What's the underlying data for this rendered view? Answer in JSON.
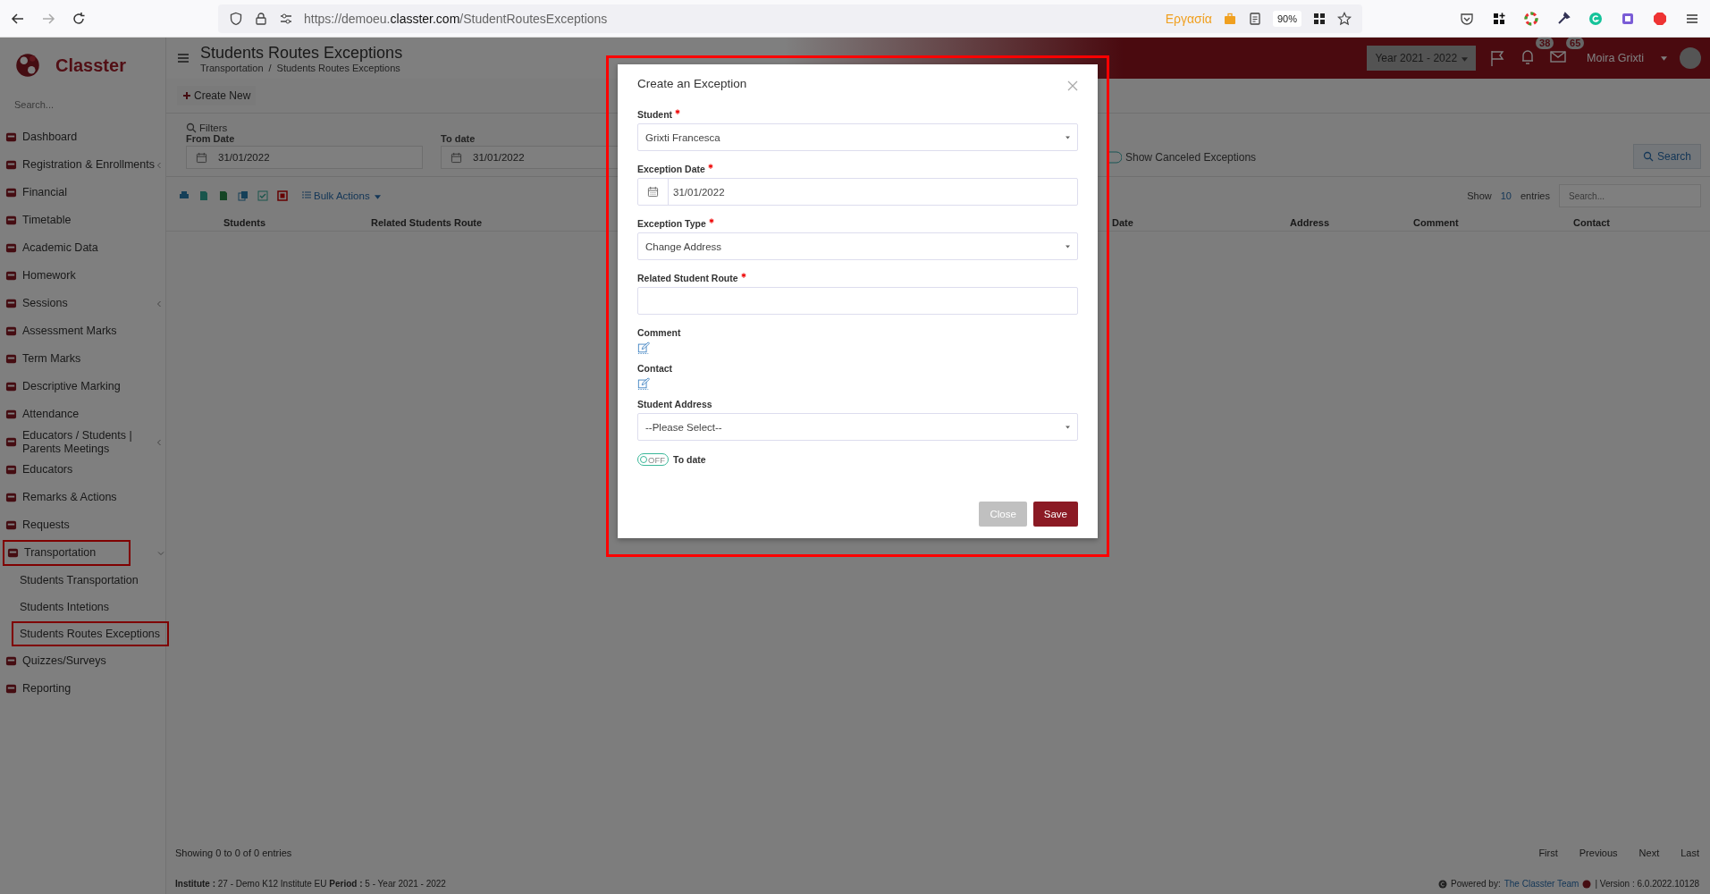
{
  "browser": {
    "url_start": "https://demoeu.",
    "url_domain": "classter.com",
    "url_path": "/StudentRoutesExceptions",
    "container": "Εργασία",
    "zoom": "90%"
  },
  "header": {
    "logo": "Classter",
    "search_placeholder": "Search...",
    "title": "Students Routes Exceptions",
    "breadcrumb": [
      "Transportation",
      "Students Routes Exceptions"
    ],
    "breadcrumb_separator": "/",
    "year": "Year 2021 - 2022",
    "notifications": "38",
    "messages": "65",
    "user": "Moira Grixti"
  },
  "sidebar": {
    "items": [
      {
        "label": "Dashboard",
        "kind": "link",
        "annotated": false
      },
      {
        "label": "Registration & Enrollments",
        "kind": "group",
        "annotated": false
      },
      {
        "label": "Financial",
        "kind": "link",
        "annotated": false
      },
      {
        "label": "Timetable",
        "kind": "link",
        "annotated": false
      },
      {
        "label": "Academic Data",
        "kind": "link",
        "annotated": false
      },
      {
        "label": "Homework",
        "kind": "link",
        "annotated": false
      },
      {
        "label": "Sessions",
        "kind": "group",
        "annotated": false
      },
      {
        "label": "Assessment Marks",
        "kind": "link",
        "annotated": false
      },
      {
        "label": "Term Marks",
        "kind": "link",
        "annotated": false
      },
      {
        "label": "Descriptive Marking",
        "kind": "link",
        "annotated": false
      },
      {
        "label": "Attendance",
        "kind": "link",
        "annotated": false
      },
      {
        "label": "Educators / Students | Parents Meetings",
        "kind": "group",
        "annotated": false
      },
      {
        "label": "Educators",
        "kind": "link",
        "annotated": false
      },
      {
        "label": "Remarks & Actions",
        "kind": "link",
        "annotated": false
      },
      {
        "label": "Requests",
        "kind": "link",
        "annotated": false
      },
      {
        "label": "Transportation",
        "kind": "group",
        "annotated": true,
        "children": [
          {
            "label": "Students Transportation",
            "annotated": false
          },
          {
            "label": "Students Intetions",
            "annotated": false
          },
          {
            "label": "Students Routes Exceptions",
            "annotated": true
          }
        ]
      },
      {
        "label": "Quizzes/Surveys",
        "kind": "link",
        "annotated": false
      },
      {
        "label": "Reporting",
        "kind": "link",
        "annotated": false
      }
    ]
  },
  "toolbar": {
    "create_label": "Create New"
  },
  "filters": {
    "title": "Filters",
    "from_label": "From Date",
    "from_value": "31/01/2022",
    "to_label": "To date",
    "to_value": "31/01/2022",
    "canceled_label": "Show Canceled Exceptions",
    "search_label": "Search"
  },
  "table": {
    "bulk_label": "Bulk Actions",
    "show_label": "Show",
    "page_size": "10",
    "entries_label": "entries",
    "search_placeholder": "Search...",
    "columns_left": [
      "Students",
      "Related Students Route"
    ],
    "columns_right": [
      "Date",
      "Address",
      "Comment",
      "Contact"
    ],
    "info": "Showing 0 to 0 of 0 entries",
    "pager": [
      "First",
      "Previous",
      "Next",
      "Last"
    ]
  },
  "status_bar": {
    "institute": "**Institute :** 27 - Demo K12 Institute EU **Period :** 5 - Year 2021 - 2022",
    "powered_label": "Powered by:",
    "powered_link": "The Classter Team",
    "version": "| Version : 6.0.2022.10128"
  },
  "modal": {
    "title": "Create an Exception",
    "annotated": true,
    "fields": [
      {
        "kind": "select",
        "label": "Student",
        "required": true,
        "value": "Grixti Francesca"
      },
      {
        "kind": "date",
        "label": "Exception Date",
        "required": true,
        "value": "31/01/2022"
      },
      {
        "kind": "select",
        "label": "Exception Type",
        "required": true,
        "value": "Change Address"
      },
      {
        "kind": "text",
        "label": "Related Student Route",
        "required": true
      },
      {
        "kind": "editor",
        "label": "Comment",
        "required": false
      },
      {
        "kind": "editor",
        "label": "Contact",
        "required": false
      },
      {
        "kind": "select",
        "label": "Student Address",
        "required": false,
        "value": "--Please Select--"
      },
      {
        "kind": "toggle",
        "label": "To date",
        "on": false,
        "state_text": "OFF"
      }
    ],
    "buttons": [
      {
        "label": "Close",
        "kind": "secondary"
      },
      {
        "label": "Save",
        "kind": "primary"
      }
    ]
  }
}
